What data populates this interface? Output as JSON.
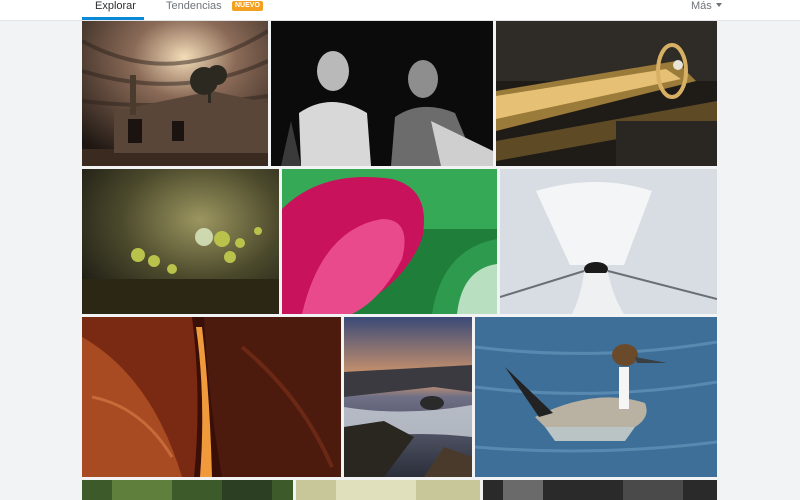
{
  "tabs": [
    {
      "label": "Explorar",
      "active": true
    },
    {
      "label": "Tendencias",
      "active": false
    }
  ],
  "badge": "NUEVO",
  "more_label": "Más",
  "accent_color": "#0a8ad6",
  "badge_color": "#f4a020",
  "photos": [
    {
      "subject": "abandoned wooden shack under dramatic sky"
    },
    {
      "subject": "black and white portrait of two men"
    },
    {
      "subject": "macro of gold ring on dark surface"
    },
    {
      "subject": "water droplet on small green sprouts"
    },
    {
      "subject": "macro of pink and green fabric"
    },
    {
      "subject": "white tulle bundle tied with black ribbon"
    },
    {
      "subject": "red sandstone slot canyon"
    },
    {
      "subject": "rocky coastline at sunset with long exposure water"
    },
    {
      "subject": "pintail duck swimming on blue water"
    },
    {
      "subject": "partial photo (green)"
    },
    {
      "subject": "partial photo (pale yellow)"
    },
    {
      "subject": "partial photo (dark monochrome)"
    }
  ]
}
